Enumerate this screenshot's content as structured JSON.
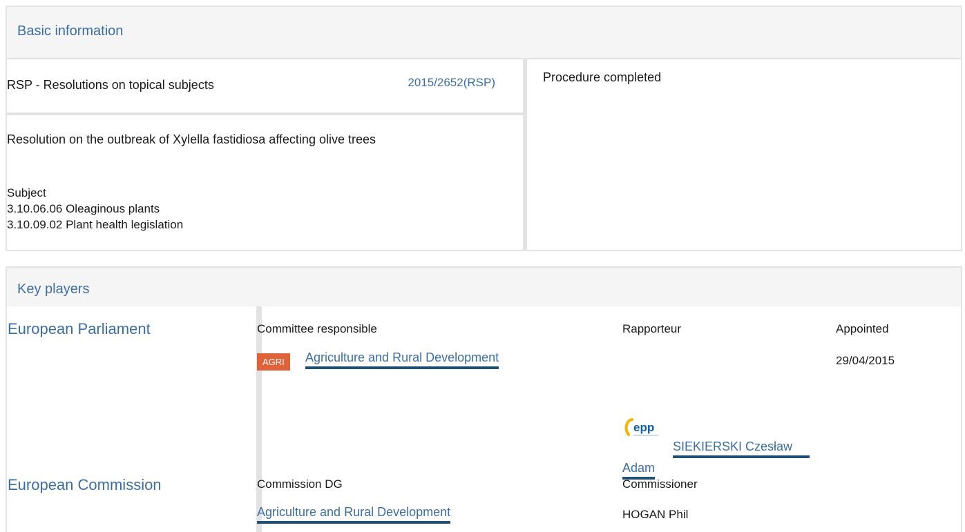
{
  "basic_info": {
    "title": "Basic information",
    "procedure_type": "RSP - Resolutions on topical subjects",
    "reference": "2015/2652(RSP)",
    "status": "Procedure completed",
    "resolution_title": "Resolution on the outbreak of Xylella fastidiosa affecting olive trees",
    "subject_heading": "Subject",
    "subjects": [
      "3.10.06.06 Oleaginous plants",
      "3.10.09.02 Plant health legislation"
    ]
  },
  "key_players": {
    "title": "Key players",
    "parliament": {
      "label": "European Parliament",
      "col_committee": "Committee responsible",
      "col_rapporteur": "Rapporteur",
      "col_appointed": "Appointed",
      "committee_code": "AGRI",
      "committee_name": "Agriculture and Rural Development",
      "appointed_date": "29/04/2015",
      "rapporteur_logo": "epp",
      "rapporteur_name_line1": "SIEKIERSKI Czesław",
      "rapporteur_name_line2": "Adam",
      "committee_tag_color": "#e0623a"
    },
    "commission": {
      "label": "European Commission",
      "col_dg": "Commission DG",
      "col_commissioner": "Commissioner",
      "dg_name": "Agriculture and Rural Development",
      "commissioner": "HOGAN Phil"
    }
  },
  "colors": {
    "accent": "#3b6ea5",
    "underline": "#1f4e79",
    "panel_bg": "#f5f5f5",
    "border": "#e3e3e3"
  }
}
